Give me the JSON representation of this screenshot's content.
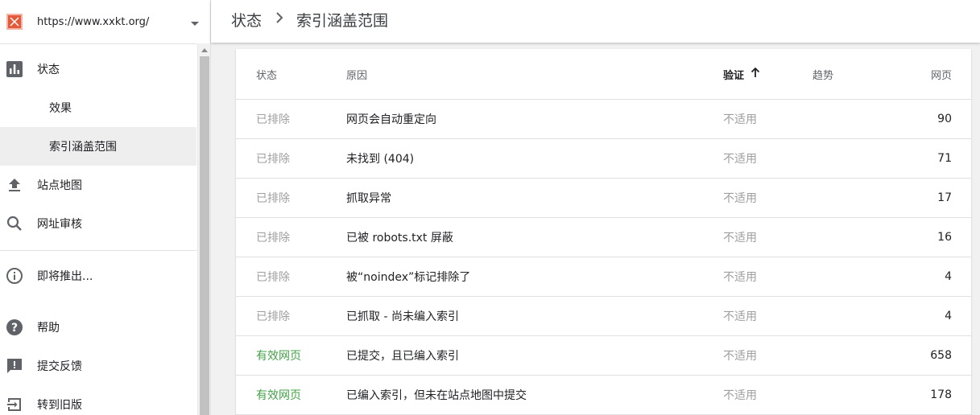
{
  "property": {
    "url": "https://www.xxkt.org/"
  },
  "nav": {
    "items": [
      {
        "label": "状态",
        "icon": "bar-chart-icon"
      },
      {
        "label": "效果",
        "sub": true
      },
      {
        "label": "索引涵盖范围",
        "sub": true,
        "active": true
      },
      {
        "label": "站点地图",
        "icon": "upload-icon"
      },
      {
        "label": "网址审核",
        "icon": "search-icon"
      },
      {
        "label": "即将推出...",
        "icon": "info-icon"
      },
      {
        "label": "帮助",
        "icon": "help-icon"
      },
      {
        "label": "提交反馈",
        "icon": "feedback-icon"
      },
      {
        "label": "转到旧版",
        "icon": "exit-icon"
      }
    ]
  },
  "breadcrumb": {
    "parent": "状态",
    "current": "索引涵盖范围"
  },
  "table": {
    "headers": {
      "status": "状态",
      "reason": "原因",
      "validation": "验证",
      "trend": "趋势",
      "pages": "网页"
    },
    "sort": {
      "column": "validation",
      "direction": "ascending"
    },
    "rows": [
      {
        "status": "已排除",
        "status_type": "excluded",
        "reason": "网页会自动重定向",
        "validation": "不适用",
        "pages": "90"
      },
      {
        "status": "已排除",
        "status_type": "excluded",
        "reason": "未找到 (404)",
        "validation": "不适用",
        "pages": "71"
      },
      {
        "status": "已排除",
        "status_type": "excluded",
        "reason": "抓取异常",
        "validation": "不适用",
        "pages": "17"
      },
      {
        "status": "已排除",
        "status_type": "excluded",
        "reason": "已被 robots.txt 屏蔽",
        "validation": "不适用",
        "pages": "16"
      },
      {
        "status": "已排除",
        "status_type": "excluded",
        "reason": "被“noindex”标记排除了",
        "validation": "不适用",
        "pages": "4"
      },
      {
        "status": "已排除",
        "status_type": "excluded",
        "reason": "已抓取 - 尚未编入索引",
        "validation": "不适用",
        "pages": "4"
      },
      {
        "status": "有效网页",
        "status_type": "valid",
        "reason": "已提交，且已编入索引",
        "validation": "不适用",
        "pages": "658"
      },
      {
        "status": "有效网页",
        "status_type": "valid",
        "reason": "已编入索引，但未在站点地图中提交",
        "validation": "不适用",
        "pages": "178"
      }
    ]
  },
  "colors": {
    "excluded": "#9e9e9e",
    "valid": "#43a047",
    "favicon": "#e2593b"
  }
}
